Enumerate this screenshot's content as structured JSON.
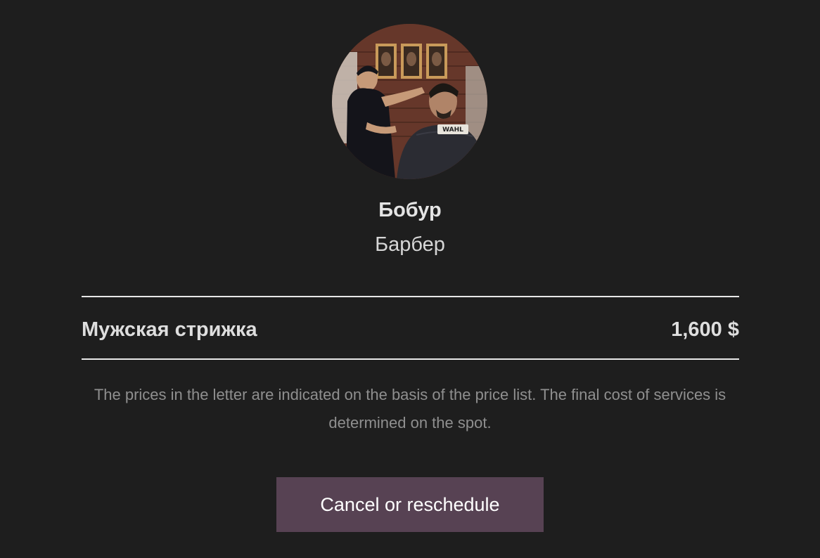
{
  "staff": {
    "name": "Бобур",
    "role": "Барбер"
  },
  "service": {
    "name": "Мужская стрижка",
    "price": "1,600 $"
  },
  "note": "The prices in the letter are indicated on the basis of the price list. The final cost of services is determined on the spot.",
  "actions": {
    "cancel_label": "Cancel or reschedule"
  },
  "colors": {
    "background": "#1e1e1e",
    "button": "#574253",
    "divider": "#e8e8e8",
    "note_text": "#8f8f8f"
  }
}
